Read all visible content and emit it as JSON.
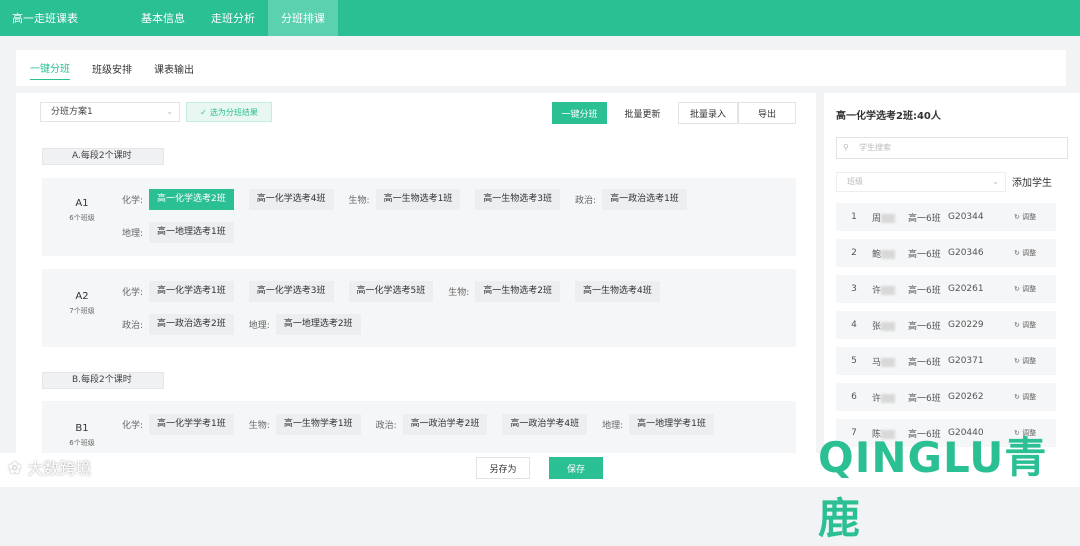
{
  "app": {
    "title": "高一走班课表"
  },
  "topnav": [
    {
      "label": "基本信息",
      "active": false
    },
    {
      "label": "走班分析",
      "active": false
    },
    {
      "label": "分班排课",
      "active": true
    }
  ],
  "subtabs": [
    {
      "label": "一键分班",
      "active": true
    },
    {
      "label": "班级安排",
      "active": false
    },
    {
      "label": "课表输出",
      "active": false
    }
  ],
  "toolbar": {
    "plan_select": "分班方案1",
    "choose_result": "选为分班结果",
    "auto_assign": "一键分班",
    "batch_update": "批量更新",
    "batch_input": "批量录入",
    "export": "导出"
  },
  "sections": [
    {
      "label": "A.每段2个课时",
      "groups": [
        {
          "name": "A1",
          "sub": "6个班级",
          "rows": [
            [
              {
                "subject": "化学:",
                "chips": [
                  {
                    "text": "高一化学选考2班",
                    "selected": true
                  },
                  {
                    "text": "高一化学选考4班"
                  }
                ]
              },
              {
                "subject": "生物:",
                "chips": [
                  {
                    "text": "高一生物选考1班"
                  },
                  {
                    "text": "高一生物选考3班"
                  }
                ]
              },
              {
                "subject": "政治:",
                "chips": [
                  {
                    "text": "高一政治选考1班"
                  }
                ]
              }
            ],
            [
              {
                "subject": "地理:",
                "chips": [
                  {
                    "text": "高一地理选考1班"
                  }
                ]
              }
            ]
          ]
        },
        {
          "name": "A2",
          "sub": "7个班级",
          "rows": [
            [
              {
                "subject": "化学:",
                "chips": [
                  {
                    "text": "高一化学选考1班"
                  },
                  {
                    "text": "高一化学选考3班"
                  },
                  {
                    "text": "高一化学选考5班"
                  }
                ]
              },
              {
                "subject": "生物:",
                "chips": [
                  {
                    "text": "高一生物选考2班"
                  },
                  {
                    "text": "高一生物选考4班"
                  }
                ]
              }
            ],
            [
              {
                "subject": "政治:",
                "chips": [
                  {
                    "text": "高一政治选考2班"
                  }
                ]
              },
              {
                "subject": "地理:",
                "chips": [
                  {
                    "text": "高一地理选考2班"
                  }
                ]
              }
            ]
          ]
        }
      ]
    },
    {
      "label": "B.每段2个课时",
      "groups": [
        {
          "name": "B1",
          "sub": "6个班级",
          "rows": [
            [
              {
                "subject": "化学:",
                "chips": [
                  {
                    "text": "高一化学学考1班"
                  }
                ]
              },
              {
                "subject": "生物:",
                "chips": [
                  {
                    "text": "高一生物学考1班"
                  }
                ]
              },
              {
                "subject": "政治:",
                "chips": [
                  {
                    "text": "高一政治学考2班"
                  },
                  {
                    "text": "高一政治学考4班"
                  }
                ]
              },
              {
                "subject": "地理:",
                "chips": [
                  {
                    "text": "高一地理学考1班"
                  }
                ]
              }
            ]
          ]
        }
      ]
    }
  ],
  "panel": {
    "title": "高一化学选考2班:40人",
    "search_placeholder": "学生搜索",
    "class_placeholder": "班级",
    "add_student": "添加学生",
    "adjust_label": "调整",
    "students": [
      {
        "no": "1",
        "surname": "周",
        "cls": "高一6班",
        "sid": "G20344"
      },
      {
        "no": "2",
        "surname": "鲍",
        "cls": "高一6班",
        "sid": "G20346"
      },
      {
        "no": "3",
        "surname": "许",
        "cls": "高一6班",
        "sid": "G20261"
      },
      {
        "no": "4",
        "surname": "张",
        "cls": "高一6班",
        "sid": "G20229"
      },
      {
        "no": "5",
        "surname": "马",
        "cls": "高一6班",
        "sid": "G20371"
      },
      {
        "no": "6",
        "surname": "许",
        "cls": "高一6班",
        "sid": "G20262"
      },
      {
        "no": "7",
        "surname": "陈",
        "cls": "高一6班",
        "sid": "G20440"
      }
    ]
  },
  "footer": {
    "save_as": "另存为",
    "save": "保存"
  },
  "watermarks": {
    "left": "大数跨境",
    "right": "QINGLU青鹿"
  },
  "colors": {
    "accent": "#2bbf94",
    "accent_light": "#5bd1af"
  }
}
